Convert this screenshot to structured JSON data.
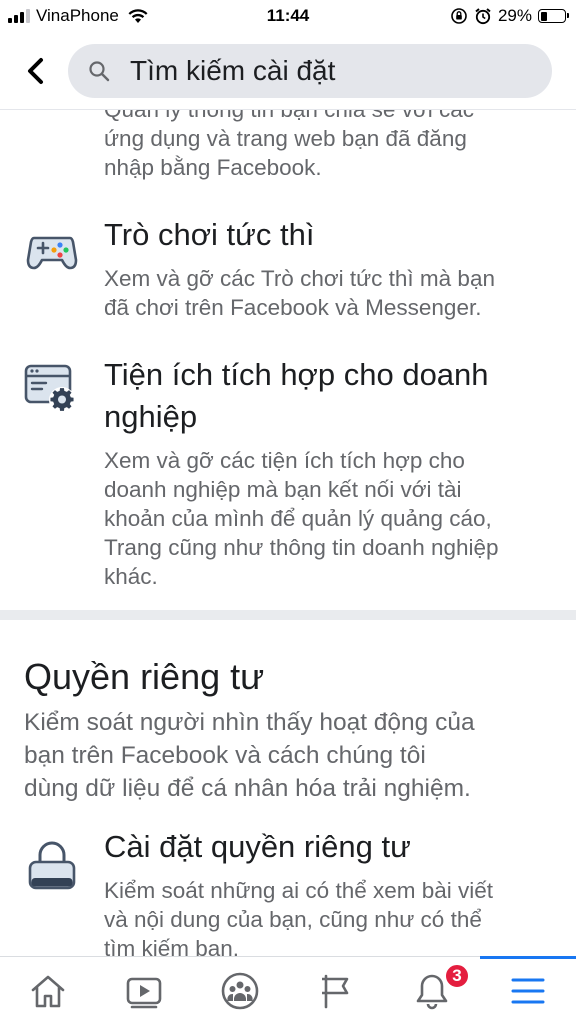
{
  "status_bar": {
    "carrier": "VinaPhone",
    "time": "11:44",
    "battery_percent": "29%",
    "battery_level": 0.29,
    "icons": [
      "signal-icon",
      "wifi-icon",
      "orientation-lock-icon",
      "alarm-icon",
      "battery-icon"
    ]
  },
  "header": {
    "back_icon": "chevron-left-icon",
    "search_icon": "search-icon",
    "search_placeholder": "Tìm kiếm cài đặt"
  },
  "items": [
    {
      "icon": "apps-websites-icon",
      "title": "",
      "description_partial_top": "Quản lý thông tin bạn chia sẻ với các",
      "description_lines": [
        "ứng dụng và trang web bạn đã đăng",
        "nhập bằng Facebook."
      ]
    },
    {
      "icon": "gamepad-icon",
      "title": "Trò chơi tức thì",
      "description_lines": [
        "Xem và gỡ các Trò chơi tức thì mà bạn",
        "đã chơi trên Facebook và Messenger."
      ]
    },
    {
      "icon": "business-integrations-icon",
      "title_lines": [
        "Tiện ích tích hợp cho doanh",
        "nghiệp"
      ],
      "description_lines": [
        "Xem và gỡ các tiện ích tích hợp cho",
        "doanh nghiệp mà bạn kết nối với tài",
        "khoản của mình để quản lý quảng cáo,",
        "Trang cũng như thông tin doanh nghiệp",
        "khác."
      ]
    }
  ],
  "privacy_section": {
    "title": "Quyền riêng tư",
    "description_lines": [
      "Kiểm soát người nhìn thấy hoạt động của",
      "bạn trên Facebook và cách chúng tôi",
      "dùng dữ liệu để cá nhân hóa trải nghiệm."
    ],
    "item": {
      "icon": "lock-icon",
      "title": "Cài đặt quyền riêng tư",
      "description_lines": [
        "Kiểm soát những ai có thể xem bài viết",
        "và nội dung của bạn, cũng như có thể",
        "tìm kiếm bạn."
      ]
    }
  },
  "bottom_nav": {
    "items": [
      {
        "icon": "home-icon",
        "active": false
      },
      {
        "icon": "watch-video-icon",
        "active": false
      },
      {
        "icon": "groups-icon",
        "active": false
      },
      {
        "icon": "pages-flag-icon",
        "active": false
      },
      {
        "icon": "notifications-bell-icon",
        "active": false,
        "badge": "3"
      },
      {
        "icon": "menu-icon",
        "active": true
      }
    ]
  },
  "colors": {
    "accent": "#1877f2",
    "badge": "#e41e3f",
    "text_primary": "#1c1e21",
    "text_secondary": "#65676b",
    "search_bg": "#e4e6eb"
  }
}
